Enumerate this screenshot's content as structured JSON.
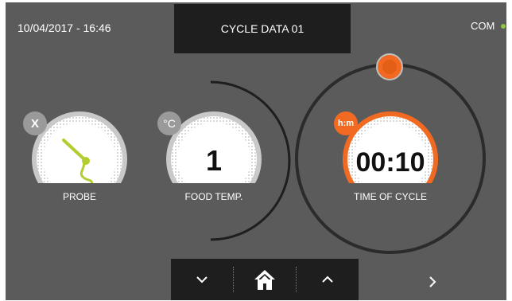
{
  "header": {
    "datetime": "10/04/2017 - 16:46",
    "title": "CYCLE DATA 01",
    "com_label": "COM"
  },
  "gauges": {
    "probe": {
      "badge": "X",
      "label": "PROBE"
    },
    "food_temp": {
      "badge": "°C",
      "value": "1",
      "label": "FOOD TEMP."
    },
    "time_of_cycle": {
      "badge": "h:m",
      "value": "00:10",
      "label": "TIME OF CYCLE"
    }
  },
  "nav": {
    "down_icon": "chevron-down-icon",
    "home_icon": "home-icon",
    "up_icon": "chevron-up-icon",
    "next_icon": "chevron-right-icon"
  },
  "colors": {
    "background": "#5b5b5b",
    "panel": "#1e1e1e",
    "accent": "#f26a21",
    "status_dot": "#8ec63f",
    "probe_icon": "#b5cc2e"
  }
}
